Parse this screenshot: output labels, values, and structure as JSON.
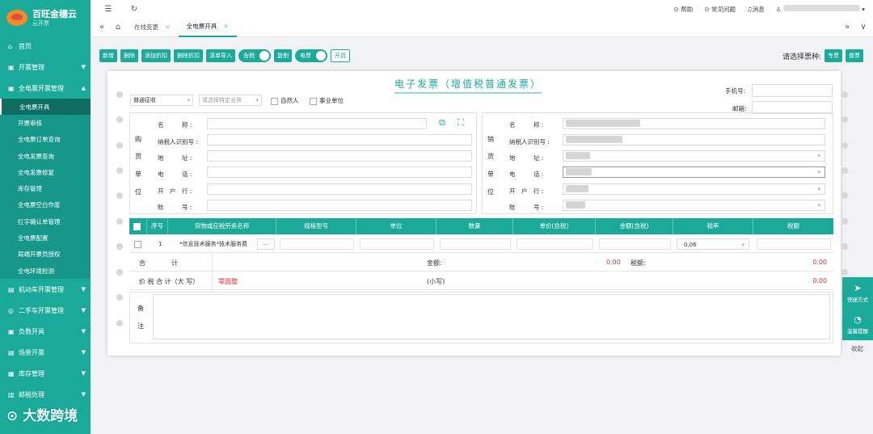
{
  "brand": {
    "title": "百旺金穗云",
    "subtitle": "云开票"
  },
  "sidebar": {
    "items": [
      {
        "label": "首页",
        "icon": "home-icon"
      },
      {
        "label": "开票管理",
        "icon": "invoice-icon"
      },
      {
        "label": "全电票开票管理",
        "icon": "invoice-icon"
      }
    ],
    "sub_items": [
      "全电票开具",
      "开票审核",
      "全电票订单查询",
      "全电发票查询",
      "全电发票修复",
      "库存管理",
      "全电票空白作废",
      "红字确认单管理",
      "全电票配置",
      "局端开票员授权",
      "全电环境检测"
    ],
    "bottom_items": [
      {
        "label": "机动车开票管理",
        "icon": "car-icon"
      },
      {
        "label": "二手车开票管理",
        "icon": "car-icon"
      },
      {
        "label": "负数开具",
        "icon": "minus-icon"
      },
      {
        "label": "场景开票",
        "icon": "scene-icon"
      },
      {
        "label": "库存管理",
        "icon": "box-icon"
      },
      {
        "label": "邮税处理",
        "icon": "mail-icon"
      }
    ]
  },
  "topbar": {
    "help": "帮助",
    "faq": "常见问题",
    "messages": "消息"
  },
  "tabs": [
    {
      "label": "在线变更"
    },
    {
      "label": "全电票开具"
    }
  ],
  "toolbar": {
    "buttons": [
      "新增",
      "删除",
      "添加折扣",
      "删除折扣",
      "清单导入"
    ],
    "toggle_tax": "含税",
    "copy": "复制",
    "toggle_email": "电票",
    "issue": "开具"
  },
  "type_pick": {
    "label": "请选择票种:",
    "special": "专票",
    "normal": "普票"
  },
  "invoice": {
    "title": "电子发票（增值税普通发票）",
    "levy_type": "普通征收",
    "special_business_placeholder": "请选择特定业务",
    "natural_person": "自然人",
    "public_institution": "事业单位",
    "phone_label": "手机号:",
    "email_label": "邮箱:",
    "buyer_vertical": [
      "购",
      "货",
      "单",
      "位"
    ],
    "seller_vertical": [
      "销",
      "货",
      "单",
      "位"
    ],
    "fields": {
      "name": "名　　　称 :",
      "tax_id": "纳税人识别号 :",
      "address": "地　　　址 :",
      "phone": "电　　　话 :",
      "bank": "开　户　行 :",
      "account": "账　　　号 :"
    }
  },
  "table": {
    "headers": [
      "序号",
      "货物或应税劳务名称",
      "规格型号",
      "单位",
      "数量",
      "单价(含税)",
      "金额(含税)",
      "税率",
      "税额"
    ],
    "rows": [
      {
        "no": "1",
        "name": "*信息技术服务*技术服务费",
        "more": "···",
        "tax_rate": "0.06"
      }
    ],
    "sum_label": "合　　　　计",
    "amount_label": "金额:",
    "amount_value": "0.00",
    "tax_label": "税额:",
    "tax_value": "0.00",
    "total_label": "价 税 合 计（大 写）",
    "total_upper": "零圆整",
    "total_lower_label": "(小写)",
    "total_lower_value": "0.00"
  },
  "remark": {
    "label_1": "备",
    "label_2": "注"
  },
  "float": {
    "quick": "快捷方式",
    "notify": "温馨提醒",
    "collapse": "收起"
  },
  "watermark": "大数跨境"
}
